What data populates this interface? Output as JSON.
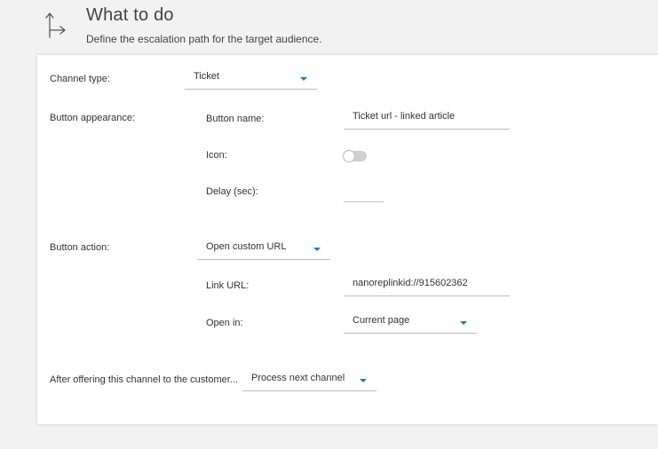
{
  "header": {
    "icon": "escalation-path-icon",
    "title": "What to do",
    "subtitle": "Define the escalation path for the target audience."
  },
  "form": {
    "channel_type": {
      "label": "Channel type:",
      "value": "Ticket"
    },
    "button_appearance": {
      "label": "Button appearance:",
      "button_name_label": "Button name:",
      "button_name_value": "Ticket url - linked article",
      "icon_label": "Icon:",
      "icon_enabled": false,
      "delay_label": "Delay (sec):",
      "delay_value": ""
    },
    "button_action": {
      "label": "Button action:",
      "value": "Open custom URL",
      "link_url_label": "Link URL:",
      "link_url_value": "nanoreplinkid://915602362",
      "open_in_label": "Open in:",
      "open_in_value": "Current page"
    },
    "after_offering": {
      "label": "After offering this channel to the customer...",
      "value": "Process next channel"
    }
  },
  "colors": {
    "accent": "#1a7fb5",
    "background": "#f2f2f2",
    "card": "#ffffff"
  }
}
